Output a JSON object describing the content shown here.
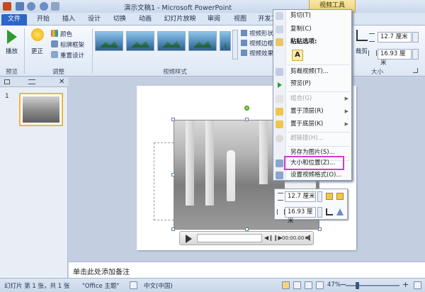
{
  "titlebar": {
    "title": "演示文稿1 - Microsoft PowerPoint",
    "context_tab": "视频工具"
  },
  "tabs": [
    "文件",
    "开始",
    "插入",
    "设计",
    "切换",
    "动画",
    "幻灯片放映",
    "审阅",
    "视图",
    "开发工"
  ],
  "ribbon": {
    "preview": {
      "play": "播放",
      "group": "预览"
    },
    "adjust": {
      "correct": "更正",
      "color": "颜色",
      "poster_frame": "标牌框架",
      "reset_design": "重置设计",
      "group": "调整"
    },
    "video_styles": {
      "shape": "视频形状",
      "border": "视频边框",
      "effects": "视频效果",
      "group": "视频样式"
    },
    "size": {
      "crop": "裁剪",
      "height": "12.7 厘米",
      "width": "16.93 厘米",
      "group": "大小"
    }
  },
  "slide_panel": {
    "slide_number": "1"
  },
  "mini_toolbar": {
    "height": "12.7 厘米",
    "width": "16.93 厘米"
  },
  "player": {
    "time": "00:00.00"
  },
  "context_menu": {
    "cut": "剪切(T)",
    "copy": "复制(C)",
    "paste_options": "粘贴选项:",
    "paste_icon": "A",
    "trim": "剪裁视频(T)...",
    "preview": "预览(P)",
    "group": "组合(G)",
    "bring_front": "置于顶层(R)",
    "send_back": "置于底层(K)",
    "hyperlink": "超链接(H)...",
    "save_picture": "另存为图片(S)...",
    "size_position": "大小和位置(Z)...",
    "format_video": "设置视频格式(O)..."
  },
  "notes": {
    "placeholder": "单击此处添加备注"
  },
  "statusbar": {
    "slide_info": "幻灯片 第 1 张，共 1 张",
    "theme": "\"Office 主题\"",
    "language": "中文(中国)",
    "zoom": "47%",
    "zoom_level_pct": 47
  },
  "colors": {
    "file_tab": "#2c66c7",
    "highlight": "#d63ac8",
    "accent_context": "#efd073"
  }
}
